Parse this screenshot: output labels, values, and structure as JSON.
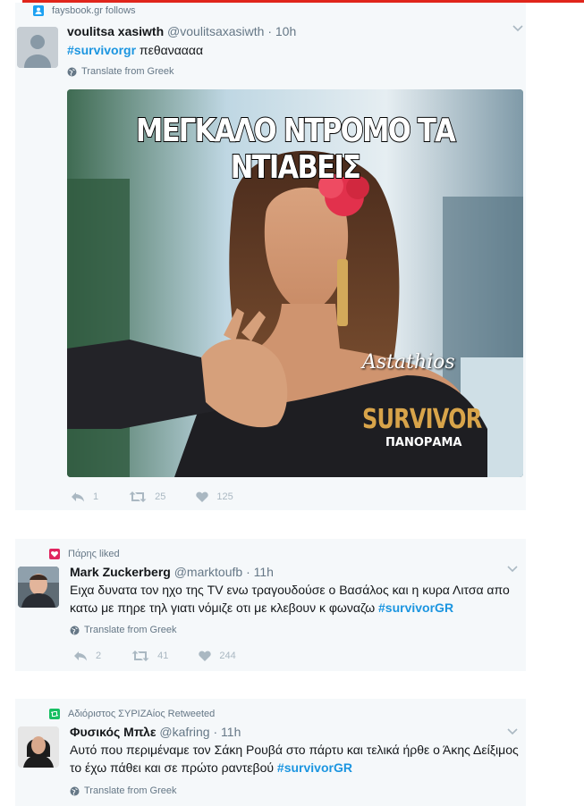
{
  "tweets": [
    {
      "context": "faysbook.gr follows",
      "context_icon": "follow-icon",
      "name": "voulitsa xasiwth",
      "handle": "@voulitsaxasiwth",
      "dot": "·",
      "time": "10h",
      "text_hashtag": "#survivorgr",
      "text_rest": " πεθαναααα",
      "translate": "Translate from Greek",
      "media": {
        "headline": "ΜΕΓΚΑΛΟ ΝΤΡΟΜΟ ΤΑ ΝΤΙΑΒΕΙΣ",
        "watermark": "Astathios",
        "logo_main": "SURVIVOR",
        "logo_sub": "ΠΑΝΟΡΑΜΑ"
      },
      "replies": "1",
      "retweets": "25",
      "likes": "125"
    },
    {
      "context": "Πάρης liked",
      "context_icon": "heart-icon",
      "name": "Mark Zuckerberg",
      "handle": "@marktoufb",
      "dot": "·",
      "time": "11h",
      "text_line1": "Ειχα δυνατα τον ηχο της TV ενω τραγουδούσε ο Βασάλος και η κυρα Λιτσα απο",
      "text_line2_pre": "κατω με πηρε τηλ γιατι νόμιζε οτι με κλεβουν κ φωναζω ",
      "text_hashtag": "#survivorGR",
      "translate": "Translate from Greek",
      "replies": "2",
      "retweets": "41",
      "likes": "244"
    },
    {
      "context": "Αδιόριστος ΣΥΡΙΖΑίος Retweeted",
      "context_icon": "retweet-icon",
      "name": "Φυσικός Μπλε",
      "handle": "@kafring",
      "dot": "·",
      "time": "11h",
      "text_line1": "Αυτό που περιμέναμε τον Σάκη Ρουβά στο πάρτυ και τελικά ήρθε ο Άκης Δείξιμος",
      "text_line2_pre": "το έχω πάθει και σε πρώτο ραντεβού ",
      "text_hashtag": "#survivorGR",
      "translate": "Translate from Greek"
    }
  ],
  "colors": {
    "accent_line": "#e0251b",
    "hashtag": "#1b95e0",
    "follow": "#1da1f2",
    "like": "#e0245e",
    "retweet": "#17bf63"
  }
}
